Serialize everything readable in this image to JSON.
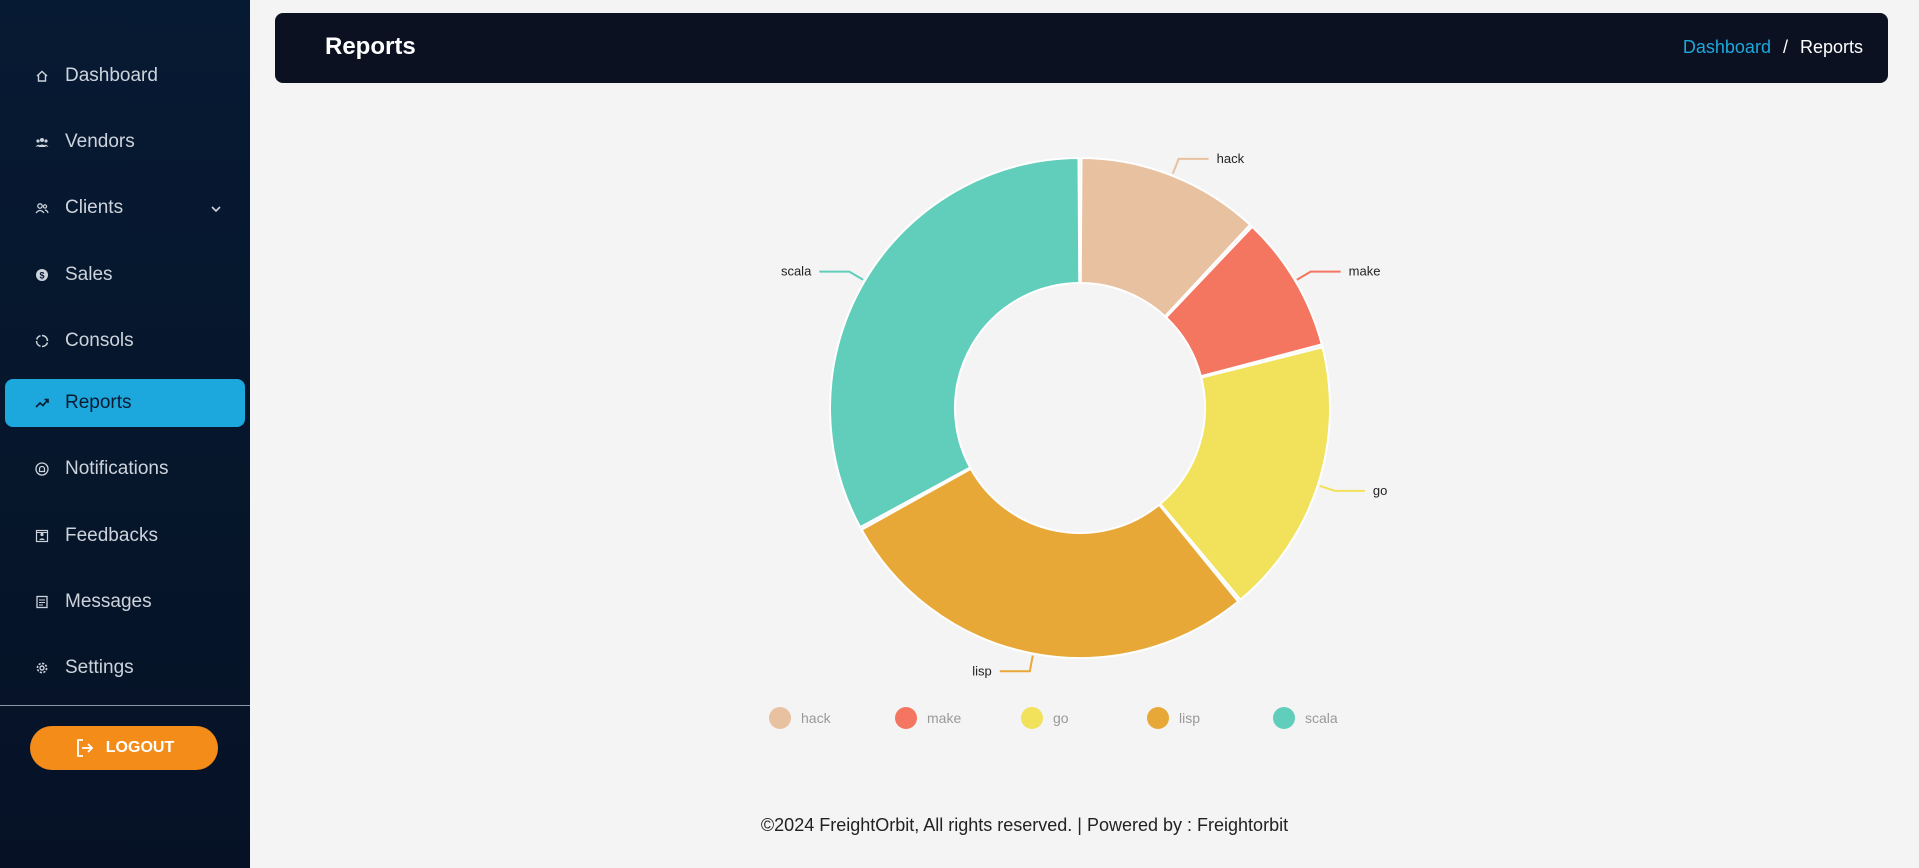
{
  "sidebar": {
    "items": [
      {
        "label": "Dashboard",
        "icon": "home-icon"
      },
      {
        "label": "Vendors",
        "icon": "users-group-icon"
      },
      {
        "label": "Clients",
        "icon": "clients-icon",
        "has_submenu": true
      },
      {
        "label": "Sales",
        "icon": "dollar-icon"
      },
      {
        "label": "Consols",
        "icon": "consols-icon"
      },
      {
        "label": "Reports",
        "icon": "trending-up-icon",
        "active": true
      },
      {
        "label": "Notifications",
        "icon": "bell-icon"
      },
      {
        "label": "Feedbacks",
        "icon": "feedback-icon"
      },
      {
        "label": "Messages",
        "icon": "messages-icon"
      },
      {
        "label": "Settings",
        "icon": "gear-icon"
      }
    ],
    "logout_label": "LOGOUT",
    "active_color": "#1ca8dd",
    "logout_color": "#f48c1a"
  },
  "header": {
    "title": "Reports",
    "breadcrumb": {
      "link": "Dashboard",
      "separator": "/",
      "current": "Reports"
    }
  },
  "chart_data": {
    "type": "pie",
    "donut": true,
    "categories": [
      "hack",
      "make",
      "go",
      "lisp",
      "scala"
    ],
    "values": [
      12,
      9,
      18,
      28,
      33
    ],
    "colors": [
      "#e8c1a0",
      "#f47560",
      "#f1e15b",
      "#e8a838",
      "#61cdbb"
    ],
    "legend_position": "bottom"
  },
  "footer": {
    "text": "©2024 FreightOrbit, All rights reserved. | Powered by : Freightorbit"
  }
}
